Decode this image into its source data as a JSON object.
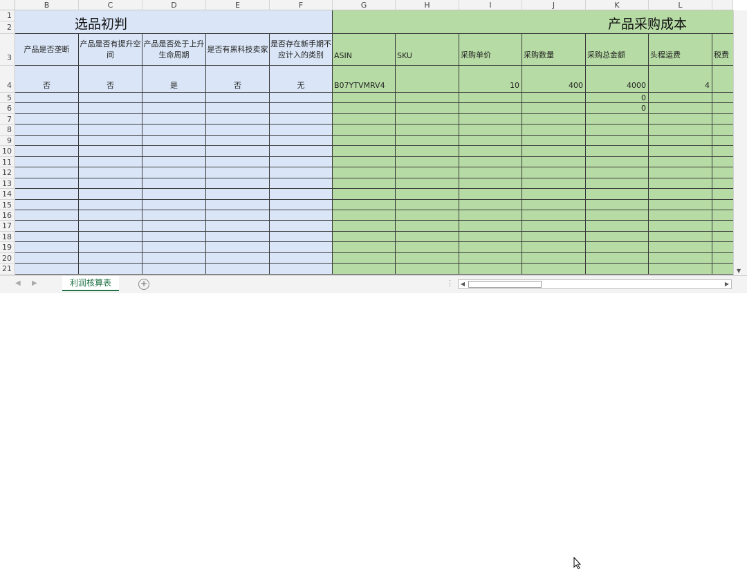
{
  "columns": [
    "B",
    "C",
    "D",
    "E",
    "F",
    "G",
    "H",
    "I",
    "J",
    "K",
    "L"
  ],
  "rows": [
    "1",
    "2",
    "3",
    "4",
    "5",
    "6",
    "7",
    "8",
    "9",
    "10",
    "11",
    "12",
    "13",
    "14",
    "15",
    "16",
    "17",
    "18",
    "19",
    "20",
    "21"
  ],
  "section_titles": {
    "selection": "选品初判",
    "purchase_cost": "产品采购成本"
  },
  "headers": {
    "B": "产品是否垄断",
    "C": "产品是否有提升空间",
    "D": "产品是否处于上升生命周期",
    "E": "是否有黑科技卖家",
    "F": "是否存在新手期不应计入的类别",
    "G": "ASIN",
    "H": "SKU",
    "I": "采购单价",
    "J": "采购数量",
    "K": "采购总金额",
    "L": "头程运费",
    "M": "税费"
  },
  "row4": {
    "B": "否",
    "C": "否",
    "D": "是",
    "E": "否",
    "F": "无",
    "G": "B07YTVMRV4",
    "H": "",
    "I": "10",
    "J": "400",
    "K": "4000",
    "L": "4"
  },
  "row5": {
    "K": "0"
  },
  "row6": {
    "K": "0"
  },
  "sheet_tab": "利润核算表",
  "colors": {
    "blue_section": "#dae6f7",
    "green_section": "#b6dba4",
    "tab_accent": "#217346"
  }
}
